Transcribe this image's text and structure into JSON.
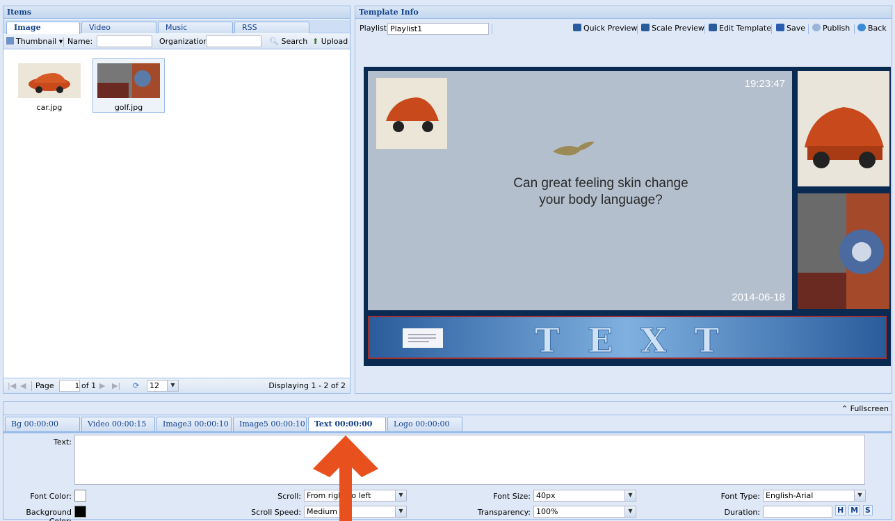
{
  "items_panel": {
    "title": "Items",
    "tabs": [
      "Image",
      "Video",
      "Music",
      "RSS"
    ],
    "toolbar": {
      "view_label": "Thumbnail",
      "name_label": "Name:",
      "name_value": "",
      "org_label": "Organization:",
      "org_value": "",
      "search_label": "Search",
      "upload_label": "Upload"
    },
    "thumbnails": [
      {
        "name": "car.jpg"
      },
      {
        "name": "golf.jpg"
      }
    ],
    "pager": {
      "page_label": "Page",
      "page_value": "1",
      "of_label": "of 1",
      "page_size": "12",
      "displaying": "Displaying 1 - 2 of 2"
    }
  },
  "template_panel": {
    "title": "Template Info",
    "playlist_label": "Playlist",
    "playlist_value": "Playlist1",
    "buttons": [
      "Quick Preview",
      "Scale Preview",
      "Edit Template",
      "Save",
      "Publish",
      "Back"
    ],
    "preview": {
      "clock": "19:23:47",
      "date": "2014-06-18",
      "headline_line1": "Can great feeling skin change",
      "headline_line2": "your body language?",
      "ticker": "TEXT"
    }
  },
  "fullscreen_label": "Fullscreen",
  "bottom_tabs": [
    {
      "label": "Bg  00:00:00"
    },
    {
      "label": "Video 00:00:15"
    },
    {
      "label": "Image3 00:00:10"
    },
    {
      "label": "Image5 00:00:10"
    },
    {
      "label": "Text 00:00:00"
    },
    {
      "label": "Logo 00:00:00"
    }
  ],
  "form": {
    "text_label": "Text:",
    "text_value": "",
    "font_color_label": "Font Color:",
    "bg_color_label": "Background Color:",
    "scroll_label": "Scroll:",
    "scroll_value": "From right to left",
    "scroll_speed_label": "Scroll Speed:",
    "scroll_speed_value": "Medium",
    "font_size_label": "Font Size:",
    "font_size_value": "40px",
    "transparency_label": "Transparency:",
    "transparency_value": "100%",
    "font_type_label": "Font Type:",
    "font_type_value": "English-Arial",
    "duration_label": "Duration:",
    "duration_value": "",
    "duration_units": [
      "H",
      "M",
      "S"
    ],
    "font_color": "#ffffff",
    "bg_color": "#000000"
  },
  "colors": {
    "accent": "#15428b",
    "border": "#99bbe8",
    "arrow": "#e8501e"
  }
}
